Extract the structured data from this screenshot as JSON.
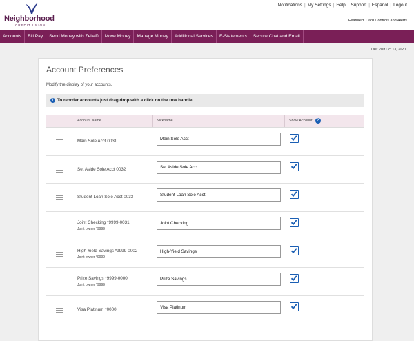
{
  "brand": {
    "name": "Neighborhood",
    "sub": "CREDIT UNION"
  },
  "toplinks": [
    "Notifications",
    "My Settings",
    "Help",
    "Support",
    "Español",
    "Logout"
  ],
  "featured": "Featured:  Card Controls and Alerts",
  "nav": [
    "Accounts",
    "Bill Pay",
    "Send Money with Zelle®",
    "Move Money",
    "Manage Money",
    "Additional Services",
    "E-Statements",
    "Secure Chat and Email"
  ],
  "last_visit": "Last Visit Oct 13, 2020",
  "page": {
    "title": "Account Preferences",
    "subtitle": "Modify the display of your accounts.",
    "info": "To reorder accounts just drag drop with a click on the row handle."
  },
  "table": {
    "headers": {
      "account_name": "Account Name",
      "nickname": "Nickname",
      "show_account": "Show Account"
    },
    "rows": [
      {
        "name": "Main Sole Acct  0031",
        "owner": "",
        "nickname": "Main Sole Acct",
        "show": true
      },
      {
        "name": "Set Aside Sole Acct  0032",
        "owner": "",
        "nickname": "Set Aside Sole Acct",
        "show": true
      },
      {
        "name": "Student Loan Sole Acct  0033",
        "owner": "",
        "nickname": "Student Loan Sole Acct",
        "show": true
      },
      {
        "name": "Joint Checking  *9999-0031",
        "owner": "Joint owner *9999",
        "nickname": "Joint Checking",
        "show": true
      },
      {
        "name": "High-Yield Savings  *9999-0002",
        "owner": "Joint owner *9999",
        "nickname": "High-Yield Savings",
        "show": true
      },
      {
        "name": "Prize Savings  *9999-0000",
        "owner": "Joint owner *9999",
        "nickname": "Prize Savings",
        "show": true
      },
      {
        "name": "Visa Platinum  *0000",
        "owner": "",
        "nickname": "Visa Platinum",
        "show": true
      }
    ]
  },
  "colors": {
    "brand": "#7a1f57",
    "accent": "#1b5fb4"
  }
}
